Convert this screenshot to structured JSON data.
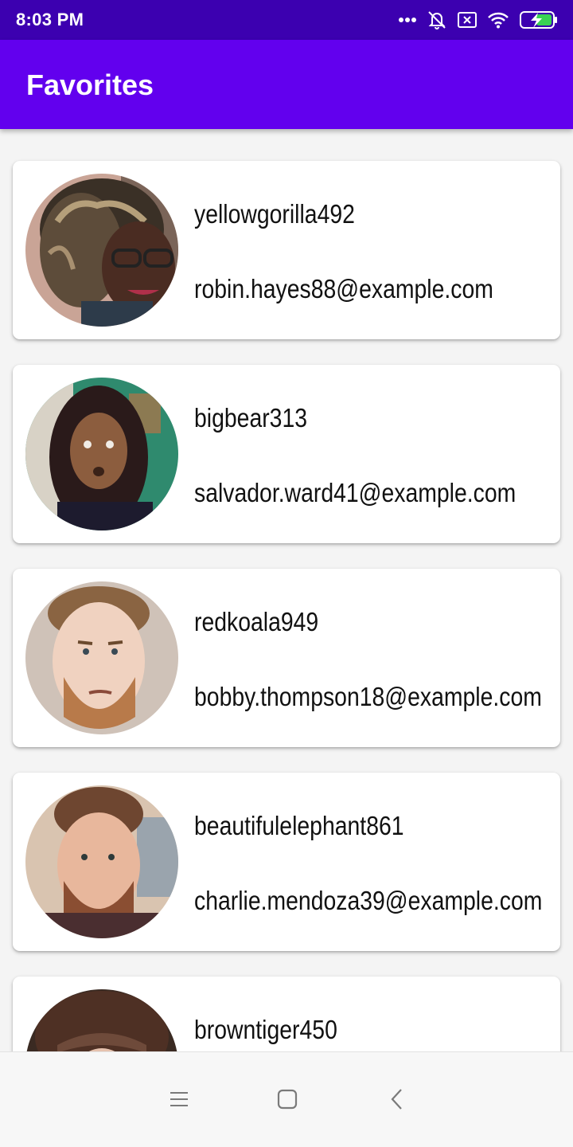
{
  "status_bar": {
    "time": "8:03 PM",
    "icons": [
      "more-dots-icon",
      "mute-bell-icon",
      "sim-off-icon",
      "wifi-icon",
      "battery-charging-icon"
    ]
  },
  "app_bar": {
    "title": "Favorites"
  },
  "favorites": [
    {
      "username": "yellowgorilla492",
      "email": "robin.hayes88@example.com"
    },
    {
      "username": "bigbear313",
      "email": "salvador.ward41@example.com"
    },
    {
      "username": "redkoala949",
      "email": "bobby.thompson18@example.com"
    },
    {
      "username": "beautifulelephant861",
      "email": "charlie.mendoza39@example.com"
    },
    {
      "username": "browntiger450",
      "email": ""
    }
  ],
  "nav_bar": {
    "icons": [
      "menu-icon",
      "home-icon",
      "back-icon"
    ]
  },
  "colors": {
    "status_bar": "#3c00b0",
    "app_bar": "#6200ee",
    "background": "#f4f4f4",
    "card": "#ffffff"
  }
}
